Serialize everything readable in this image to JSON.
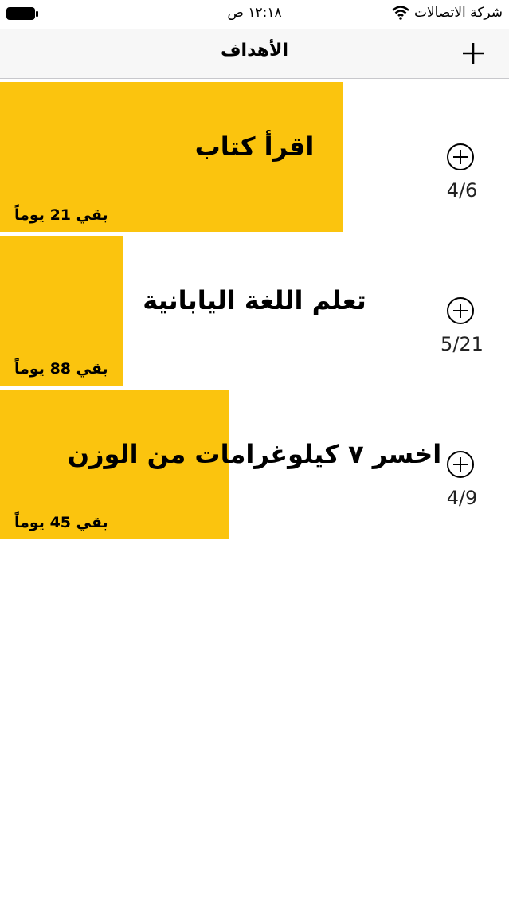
{
  "status_bar": {
    "carrier": "شركة الاتصالات",
    "time": "١٢:١٨ ص"
  },
  "nav": {
    "title": "الأهداف",
    "add_icon": "plus-icon"
  },
  "goals": [
    {
      "title": "اقرأ كتاب",
      "days_left": "بقي 21 يوماً",
      "count": "4/6",
      "progress_fraction": 0.6745
    },
    {
      "title": "تعلم اللغة اليابانية",
      "days_left": "بقي 88 يوماً",
      "count": "5/21",
      "progress_fraction": 0.2426
    },
    {
      "title": "اخسر ٧ كيلوغرامات من الوزن",
      "days_left": "بقي 45 يوماً",
      "count": "4/9",
      "progress_fraction": 0.4507
    }
  ],
  "colors": {
    "accent": "#fbc40e",
    "background": "#ffffff",
    "nav_background": "#f7f7f7"
  }
}
